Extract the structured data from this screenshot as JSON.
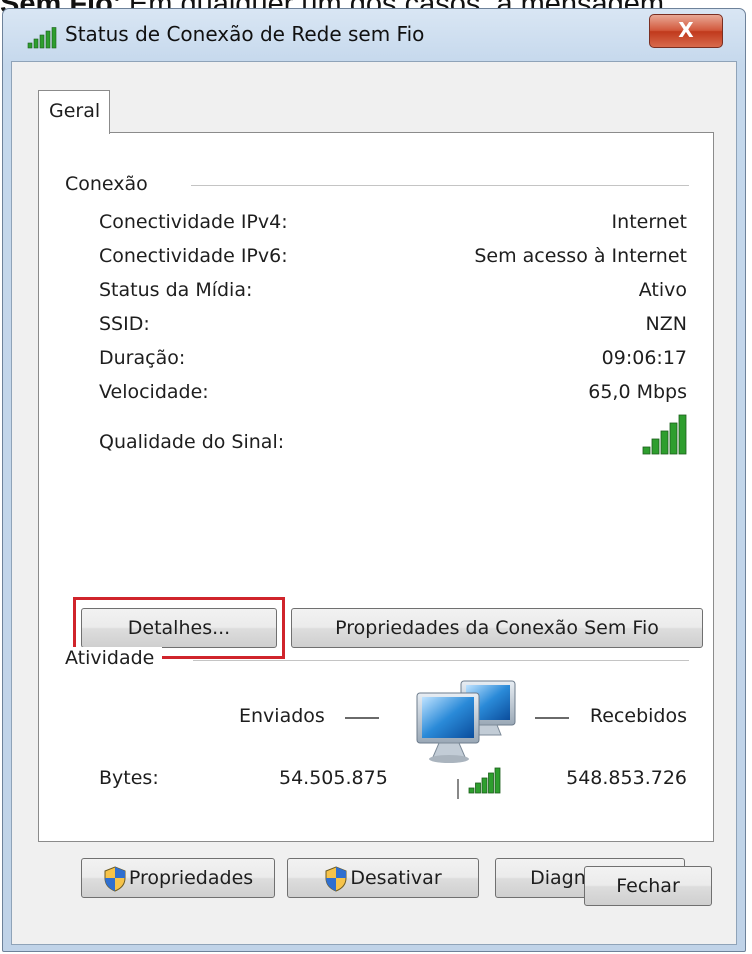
{
  "caption": {
    "prefix": "Sem Fio",
    "text": ": Em qualquer um dos casos, a mensagem"
  },
  "window": {
    "title": "Status de Conexão de Rede sem Fio",
    "close_glyph": "X"
  },
  "tabs": [
    {
      "label": "Geral"
    }
  ],
  "connection": {
    "heading": "Conexão",
    "rows": [
      {
        "label": "Conectividade IPv4:",
        "value": "Internet"
      },
      {
        "label": "Conectividade IPv6:",
        "value": "Sem acesso à Internet"
      },
      {
        "label": "Status da Mídia:",
        "value": "Ativo"
      },
      {
        "label": "SSID:",
        "value": "NZN"
      },
      {
        "label": "Duração:",
        "value": "09:06:17"
      },
      {
        "label": "Velocidade:",
        "value": "65,0 Mbps"
      },
      {
        "label": "Qualidade do Sinal:",
        "value": ""
      }
    ],
    "signal_bars": 5
  },
  "buttons": {
    "details": "Detalhes...",
    "wireless_properties": "Propriedades da Conexão Sem Fio",
    "properties": "Propriedades",
    "disable": "Desativar",
    "diagnose": "Diagnosticar",
    "close": "Fechar"
  },
  "activity": {
    "heading": "Atividade",
    "sent_label": "Enviados",
    "received_label": "Recebidos",
    "bytes_label": "Bytes:",
    "bytes_sent": "54.505.875",
    "bytes_received": "548.853.726"
  },
  "icons": {
    "title": "wireless-signal-icon",
    "signal": "signal-strength-icon",
    "network": "network-computers-icon",
    "shield": "uac-shield-icon"
  },
  "colors": {
    "highlight": "#d0242b",
    "signal_green": "#2e9e2e",
    "close_red": "#c0391c"
  }
}
